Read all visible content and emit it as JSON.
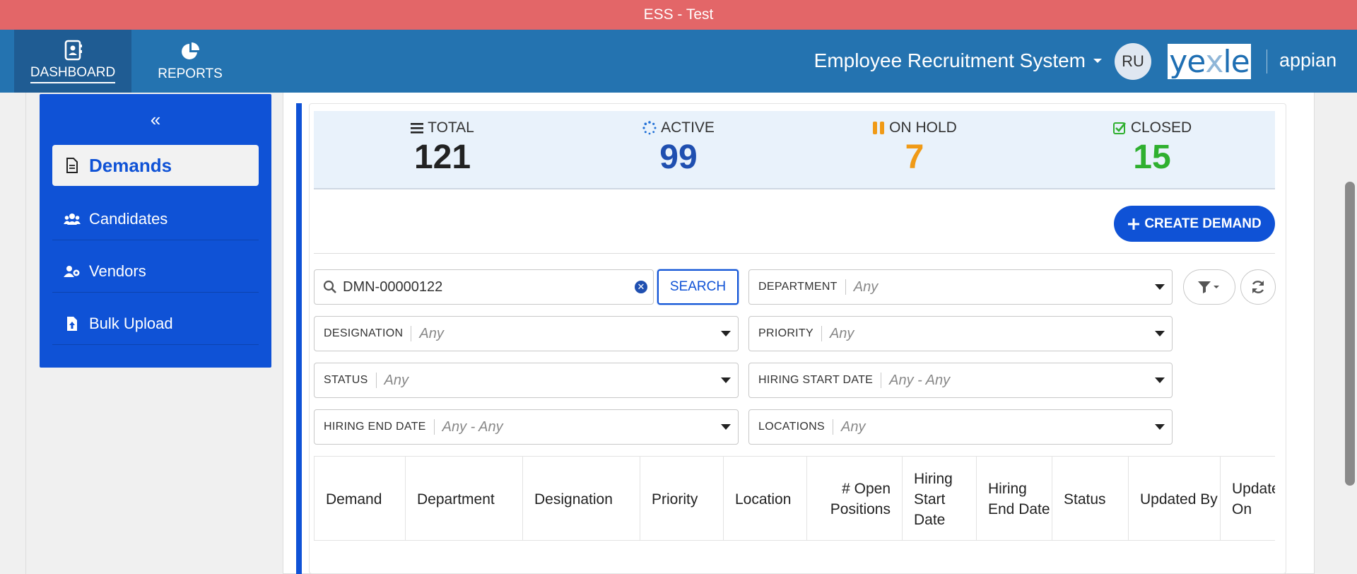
{
  "env_title": "ESS - Test",
  "nav": {
    "tabs": [
      {
        "label": "DASHBOARD",
        "icon": "contact-book-icon",
        "active": true
      },
      {
        "label": "REPORTS",
        "icon": "pie-chart-icon",
        "active": false
      }
    ],
    "app_title": "Employee Recruitment System",
    "avatar_initials": "RU",
    "logo_yexle": {
      "part1": "ye",
      "part2": "x",
      "part3": "le"
    },
    "logo_appian": "appian"
  },
  "sidebar": {
    "items": [
      {
        "label": "Demands",
        "icon": "document-icon",
        "active": true
      },
      {
        "label": "Candidates",
        "icon": "users-icon",
        "active": false
      },
      {
        "label": "Vendors",
        "icon": "user-gear-icon",
        "active": false
      },
      {
        "label": "Bulk Upload",
        "icon": "file-upload-icon",
        "active": false
      }
    ]
  },
  "kpis": [
    {
      "label": "TOTAL",
      "value": "121",
      "color": "#222222",
      "icon": "list-icon"
    },
    {
      "label": "ACTIVE",
      "value": "99",
      "color": "#1f4fb0",
      "icon": "spinner-icon"
    },
    {
      "label": "ON HOLD",
      "value": "7",
      "color": "#f09a16",
      "icon": "pause-icon"
    },
    {
      "label": "CLOSED",
      "value": "15",
      "color": "#2fb02f",
      "icon": "check-square-icon"
    }
  ],
  "create_button": "CREATE DEMAND",
  "search": {
    "value": "DMN-00000122",
    "button": "SEARCH"
  },
  "filters": {
    "department": {
      "label": "DEPARTMENT",
      "value": "Any"
    },
    "designation": {
      "label": "DESIGNATION",
      "value": "Any"
    },
    "priority": {
      "label": "PRIORITY",
      "value": "Any"
    },
    "status": {
      "label": "STATUS",
      "value": "Any"
    },
    "hiring_start_date": {
      "label": "HIRING START DATE",
      "value": "Any - Any"
    },
    "hiring_end_date": {
      "label": "HIRING END DATE",
      "value": "Any - Any"
    },
    "locations": {
      "label": "LOCATIONS",
      "value": "Any"
    }
  },
  "table": {
    "columns": [
      "Demand",
      "Department",
      "Designation",
      "Priority",
      "Location",
      "# Open Positions",
      "Hiring Start Date",
      "Hiring End Date",
      "Status",
      "Updated By",
      "Updated On"
    ]
  },
  "colors": {
    "env_bar": "#e36668",
    "nav": "#2473b0",
    "accent": "#0f52d6"
  }
}
